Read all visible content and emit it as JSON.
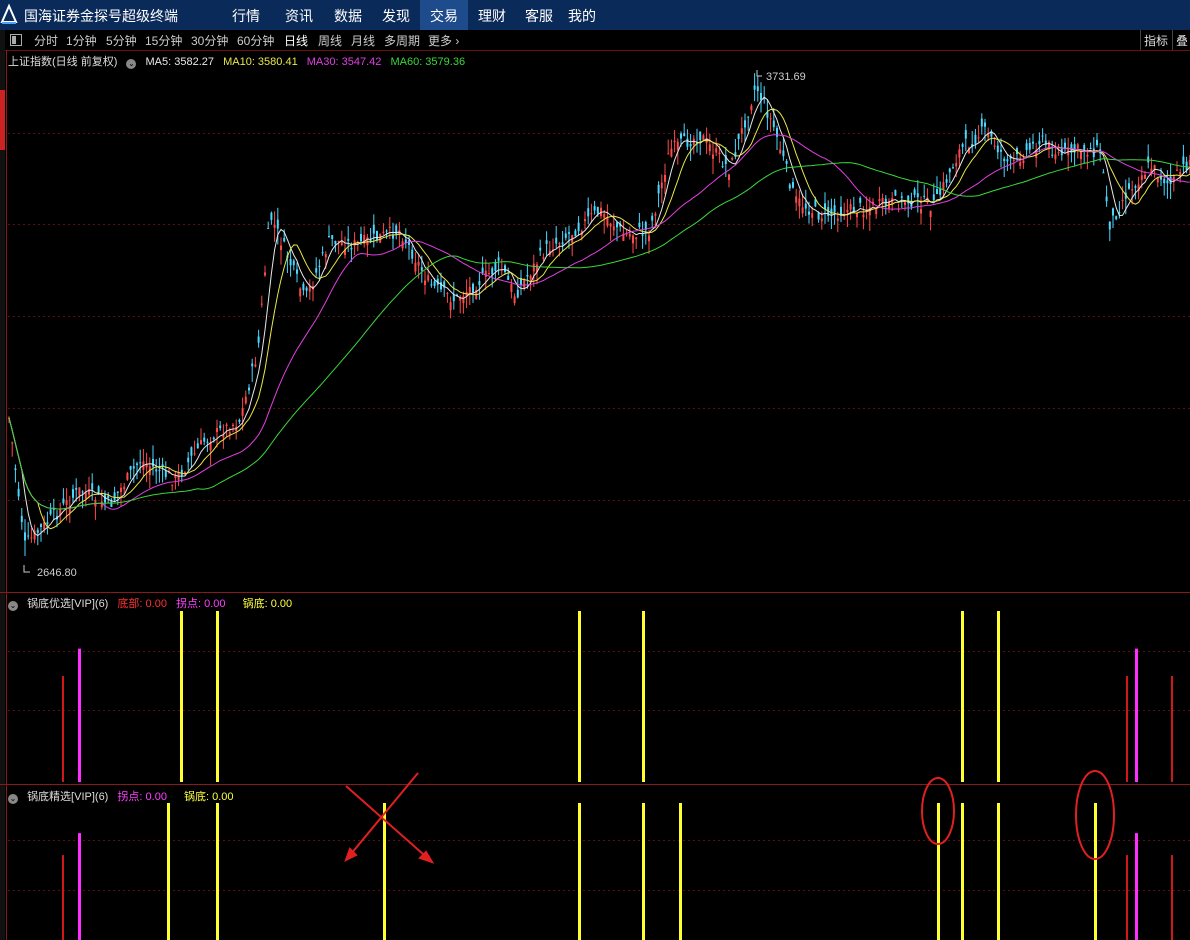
{
  "app": {
    "title": "国海证券金探号超级终端"
  },
  "nav": [
    "行情",
    "资讯",
    "数据",
    "发现",
    "交易",
    "理财",
    "客服",
    "我的"
  ],
  "nav_active": "交易",
  "periods": [
    "分时",
    "1分钟",
    "5分钟",
    "15分钟",
    "30分钟",
    "60分钟",
    "日线",
    "周线",
    "月线",
    "多周期",
    "更多"
  ],
  "period_active": "日线",
  "right_buttons": {
    "indicator": "指标",
    "overlay": "叠"
  },
  "main_panel": {
    "title": "上证指数(日线 前复权)",
    "ma": [
      {
        "label": "MA5: 3582.27",
        "color": "#e8e8e8"
      },
      {
        "label": "MA10: 3580.41",
        "color": "#e8e84a"
      },
      {
        "label": "MA30: 3547.42",
        "color": "#e040e0"
      },
      {
        "label": "MA60: 3579.36",
        "color": "#3ad83a"
      }
    ],
    "high_label": "3731.69",
    "low_label": "2646.80"
  },
  "panel1": {
    "title": "锅底优选[VIP](6)",
    "fields": [
      {
        "label": "底部: 0.00",
        "color": "#ff3030"
      },
      {
        "label": "拐点: 0.00",
        "color": "#ff40ff"
      },
      {
        "label": "锅底: 0.00",
        "color": "#ffff40"
      }
    ]
  },
  "panel2": {
    "title": "锅底精选[VIP](6)",
    "fields": [
      {
        "label": "拐点: 0.00",
        "color": "#ff40ff"
      },
      {
        "label": "锅底: 0.00",
        "color": "#ffff40"
      }
    ]
  },
  "chart_data": {
    "type": "candlestick",
    "title": "上证指数(日线 前复权)",
    "high": 3731.69,
    "low": 2646.8,
    "series": [
      {
        "name": "MA5",
        "last": 3582.27
      },
      {
        "name": "MA10",
        "last": 3580.41
      },
      {
        "name": "MA30",
        "last": 3547.42
      },
      {
        "name": "MA60",
        "last": 3579.36
      }
    ],
    "signals_panel1": {
      "底部": [
        {
          "bar": 63,
          "value": 0.62
        },
        {
          "bar": 1127,
          "value": 0.62
        },
        {
          "bar": 1172,
          "value": 0.62
        }
      ],
      "拐点": [
        {
          "bar": 79,
          "value": 0.78
        },
        {
          "bar": 1136,
          "value": 0.78
        }
      ],
      "锅底": [
        {
          "bar": 181,
          "value": 1.0
        },
        {
          "bar": 217,
          "value": 1.0
        },
        {
          "bar": 579,
          "value": 1.0
        },
        {
          "bar": 643,
          "value": 1.0
        },
        {
          "bar": 962,
          "value": 1.0
        },
        {
          "bar": 998,
          "value": 1.0
        }
      ]
    },
    "signals_panel2": {
      "底部": [
        {
          "bar": 63,
          "value": 0.62
        },
        {
          "bar": 1127,
          "value": 0.62
        },
        {
          "bar": 1172,
          "value": 0.62
        }
      ],
      "拐点": [
        {
          "bar": 79,
          "value": 0.78
        },
        {
          "bar": 1136,
          "value": 0.78
        }
      ],
      "锅底": [
        {
          "bar": 168,
          "value": 1.0
        },
        {
          "bar": 217,
          "value": 1.0
        },
        {
          "bar": 384,
          "value": 1.0
        },
        {
          "bar": 579,
          "value": 1.0
        },
        {
          "bar": 643,
          "value": 1.0
        },
        {
          "bar": 680,
          "value": 1.0
        },
        {
          "bar": 938,
          "value": 1.0
        },
        {
          "bar": 962,
          "value": 1.0
        },
        {
          "bar": 998,
          "value": 1.0
        },
        {
          "bar": 1095,
          "value": 1.0
        }
      ]
    }
  }
}
